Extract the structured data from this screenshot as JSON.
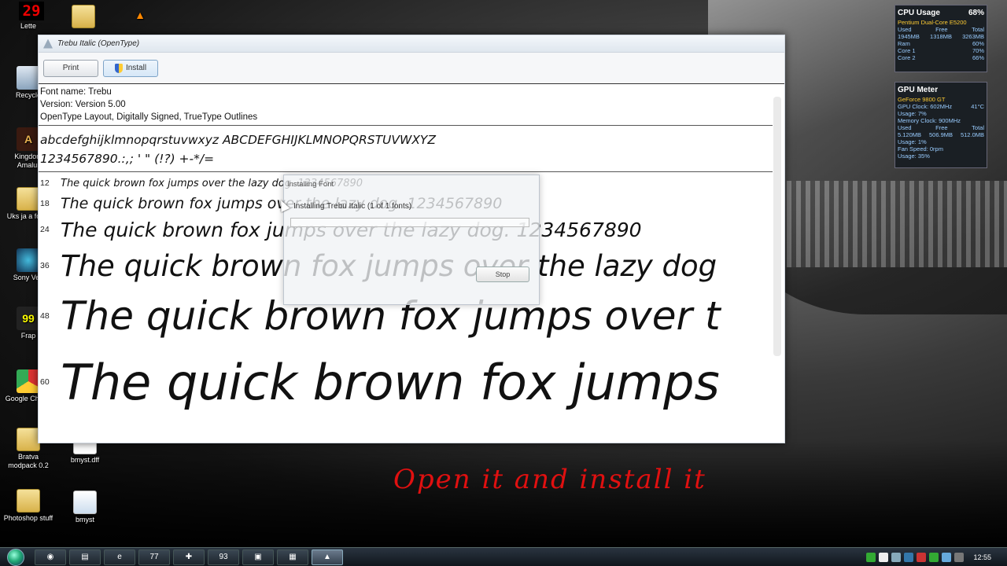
{
  "desktop": {
    "counter": "29",
    "icons": [
      {
        "label": "Lette",
        "glyph": ""
      },
      {
        "label": "Recycle",
        "glyph": ""
      },
      {
        "label": "Kingdom Amalur",
        "glyph": "A"
      },
      {
        "label": "Uks ja a folde",
        "glyph": ""
      },
      {
        "label": "Sony Veg",
        "glyph": ""
      },
      {
        "label": "Frap",
        "glyph": "99"
      },
      {
        "label": "Google Chrom",
        "glyph": ""
      },
      {
        "label": "Bratva modpack 0.2",
        "glyph": ""
      },
      {
        "label": "bmyst.dff",
        "glyph": ""
      },
      {
        "label": "Photoshop stuff",
        "glyph": ""
      },
      {
        "label": "bmyst",
        "glyph": ""
      },
      {
        "label": "",
        "glyph": "▲"
      }
    ]
  },
  "window": {
    "title": "Trebu Italic (OpenType)",
    "print_label": "Print",
    "install_label": "Install",
    "info": {
      "font_name": "Font name: Trebu",
      "version": "Version: Version 5.00",
      "details": "OpenType Layout, Digitally Signed, TrueType Outlines"
    },
    "charset_line1": "abcdefghijklmnopqrstuvwxyz ABCDEFGHIJKLMNOPQRSTUVWXYZ",
    "charset_line2": "1234567890.:,; ' \" (!?) +-*/=",
    "samples": [
      {
        "size": "12",
        "text": "The quick brown fox jumps over the lazy dog. 1234567890"
      },
      {
        "size": "18",
        "text": "The quick brown fox jumps over the lazy dog. 1234567890"
      },
      {
        "size": "24",
        "text": "The quick brown fox jumps over the lazy dog. 1234567890"
      },
      {
        "size": "36",
        "text": "The quick brown fox jumps over the lazy dog"
      },
      {
        "size": "48",
        "text": "The quick brown fox jumps over t"
      },
      {
        "size": "60",
        "text": "The quick brown fox jumps"
      }
    ]
  },
  "dialog": {
    "title": "Installing Font",
    "message": "Installing Trebu Italic (1 of 1 fonts)",
    "stop_label": "Stop",
    "progress": 0.0
  },
  "annotation": "Open it and install it",
  "gadgets": {
    "cpu": {
      "title": "CPU Usage",
      "percent": "68%",
      "model": "Pentium Dual-Core E5200",
      "headers": [
        "Used",
        "Free",
        "Total"
      ],
      "mem": [
        "1945MB",
        "1318MB",
        "3263MB"
      ],
      "rows": [
        {
          "label": "Ram",
          "value": "60%"
        },
        {
          "label": "Core 1",
          "value": "70%"
        },
        {
          "label": "Core 2",
          "value": "66%"
        }
      ]
    },
    "gpu": {
      "title": "GPU Meter",
      "model": "GeForce 9800 GT",
      "clock": "GPU Clock: 602MHz",
      "temp": "41°C",
      "usage": "Usage: 7%",
      "mem_clock": "Memory Clock: 900MHz",
      "headers": [
        "Used",
        "Free",
        "Total"
      ],
      "mem": [
        "5.120MB",
        "506.9MB",
        "512.0MB"
      ],
      "mem_usage": "Usage: 1%",
      "fan": "Fan Speed: 0rpm",
      "fan_usage": "Usage: 35%"
    }
  },
  "taskbar": {
    "items": [
      "◉",
      "▤",
      "e",
      "77",
      "✚",
      "93",
      "▣",
      "▦",
      "▲"
    ],
    "clock": "12:55"
  },
  "colors": {
    "annotation": "#e01010",
    "gadget_accent": "#fc3"
  }
}
